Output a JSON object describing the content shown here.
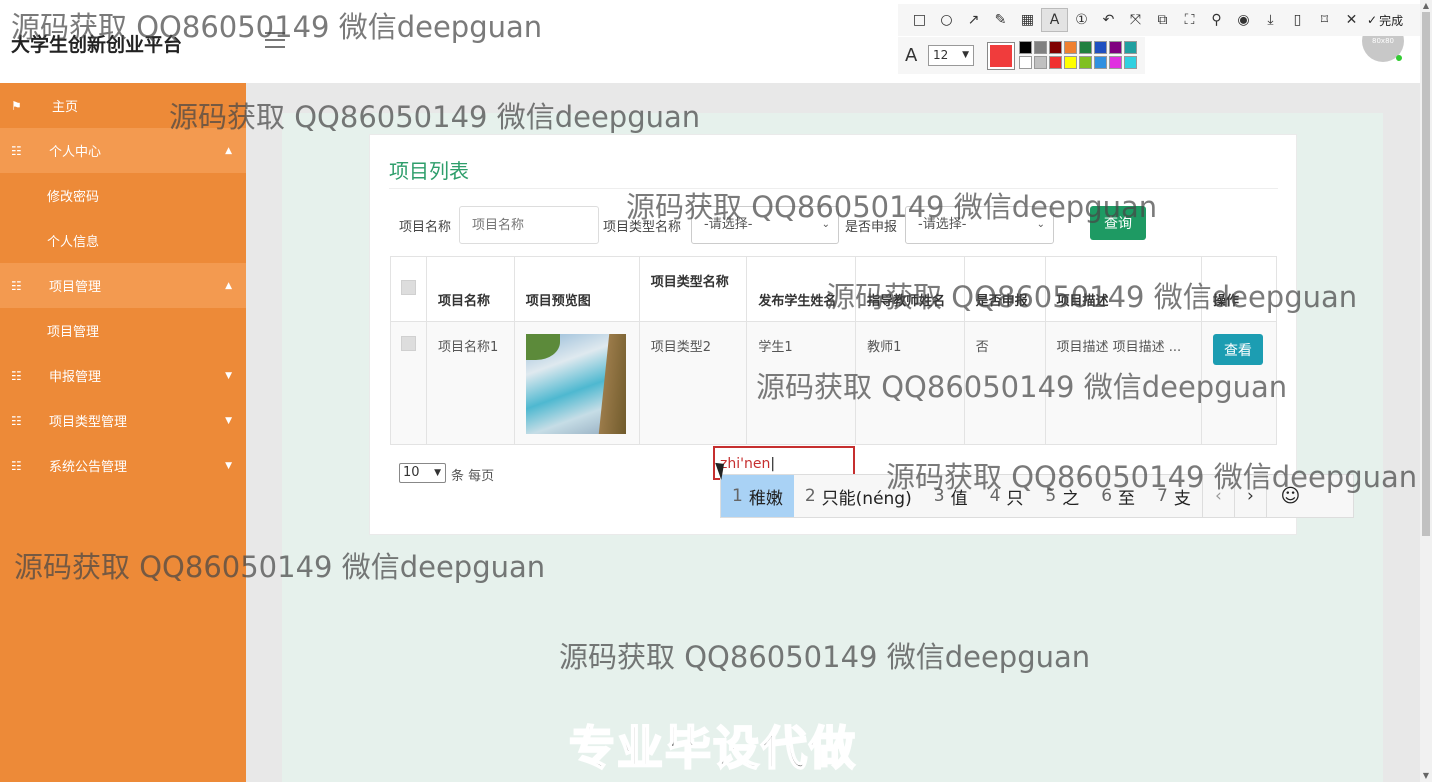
{
  "header": {
    "brand": "大学生创新创业平台",
    "avatar_text": "80x80"
  },
  "annotation_toolbar": {
    "tools": [
      "rect-icon",
      "circle-icon",
      "arrow-icon",
      "pen-icon",
      "mosaic-icon",
      "text-icon",
      "number-icon",
      "undo-icon",
      "pin-icon",
      "translate-icon",
      "ocr-icon",
      "pin2-icon",
      "record-icon",
      "download-icon",
      "save-icon",
      "bookmark-icon",
      "close-icon"
    ],
    "done_label": "完成",
    "font_size": "12",
    "current_color": "#f03c3c",
    "swatches": [
      "#000000",
      "#808080",
      "#800000",
      "#f08030",
      "#208040",
      "#2050c0",
      "#800080",
      "#20a0a0",
      "#ffffff",
      "#c0c0c0",
      "#f03030",
      "#ffff00",
      "#80c020",
      "#3090e0",
      "#e030e0",
      "#30d0e0"
    ]
  },
  "sidebar": {
    "items": [
      {
        "label": "主页",
        "icon": "flag-icon"
      },
      {
        "label": "个人中心",
        "icon": "grid-icon",
        "chevron": "▲"
      },
      {
        "label": "修改密码"
      },
      {
        "label": "个人信息"
      },
      {
        "label": "项目管理",
        "icon": "grid-icon",
        "chevron": "▲"
      },
      {
        "label": "项目管理"
      },
      {
        "label": "申报管理",
        "icon": "grid-icon",
        "chevron": "▼"
      },
      {
        "label": "项目类型管理",
        "icon": "grid-icon",
        "chevron": "▼"
      },
      {
        "label": "系统公告管理",
        "icon": "grid-icon",
        "chevron": "▼"
      }
    ]
  },
  "main": {
    "title": "项目列表",
    "filters": {
      "name_label": "项目名称",
      "name_placeholder": "项目名称",
      "type_label": "项目类型名称",
      "type_value": "-请选择-",
      "declare_label": "是否申报",
      "declare_value": "-请选择-",
      "query_label": "查询"
    },
    "table": {
      "headers": [
        "项目名称",
        "项目预览图",
        "项目类型名称",
        "发布学生姓名",
        "指导教师姓名",
        "是否申报",
        "项目描述",
        "操作"
      ],
      "rows": [
        {
          "name": "项目名称1",
          "type": "项目类型2",
          "student": "学生1",
          "teacher": "教师1",
          "declared": "否",
          "desc": "项目描述 项目描述 ...",
          "action": "查看"
        }
      ]
    },
    "pager": {
      "page_size": "10",
      "per_page_text": "条 每页"
    }
  },
  "ime": {
    "composition": "zhi'nen",
    "candidates": [
      {
        "n": "1",
        "text": "稚嫩"
      },
      {
        "n": "2",
        "text": "只能(néng)"
      },
      {
        "n": "3",
        "text": "值"
      },
      {
        "n": "4",
        "text": "只"
      },
      {
        "n": "5",
        "text": "之"
      },
      {
        "n": "6",
        "text": "至"
      },
      {
        "n": "7",
        "text": "支"
      }
    ]
  },
  "watermarks": {
    "text": "源码获取 QQ86050149 微信deepguan",
    "big_text": "专业毕设代做"
  }
}
